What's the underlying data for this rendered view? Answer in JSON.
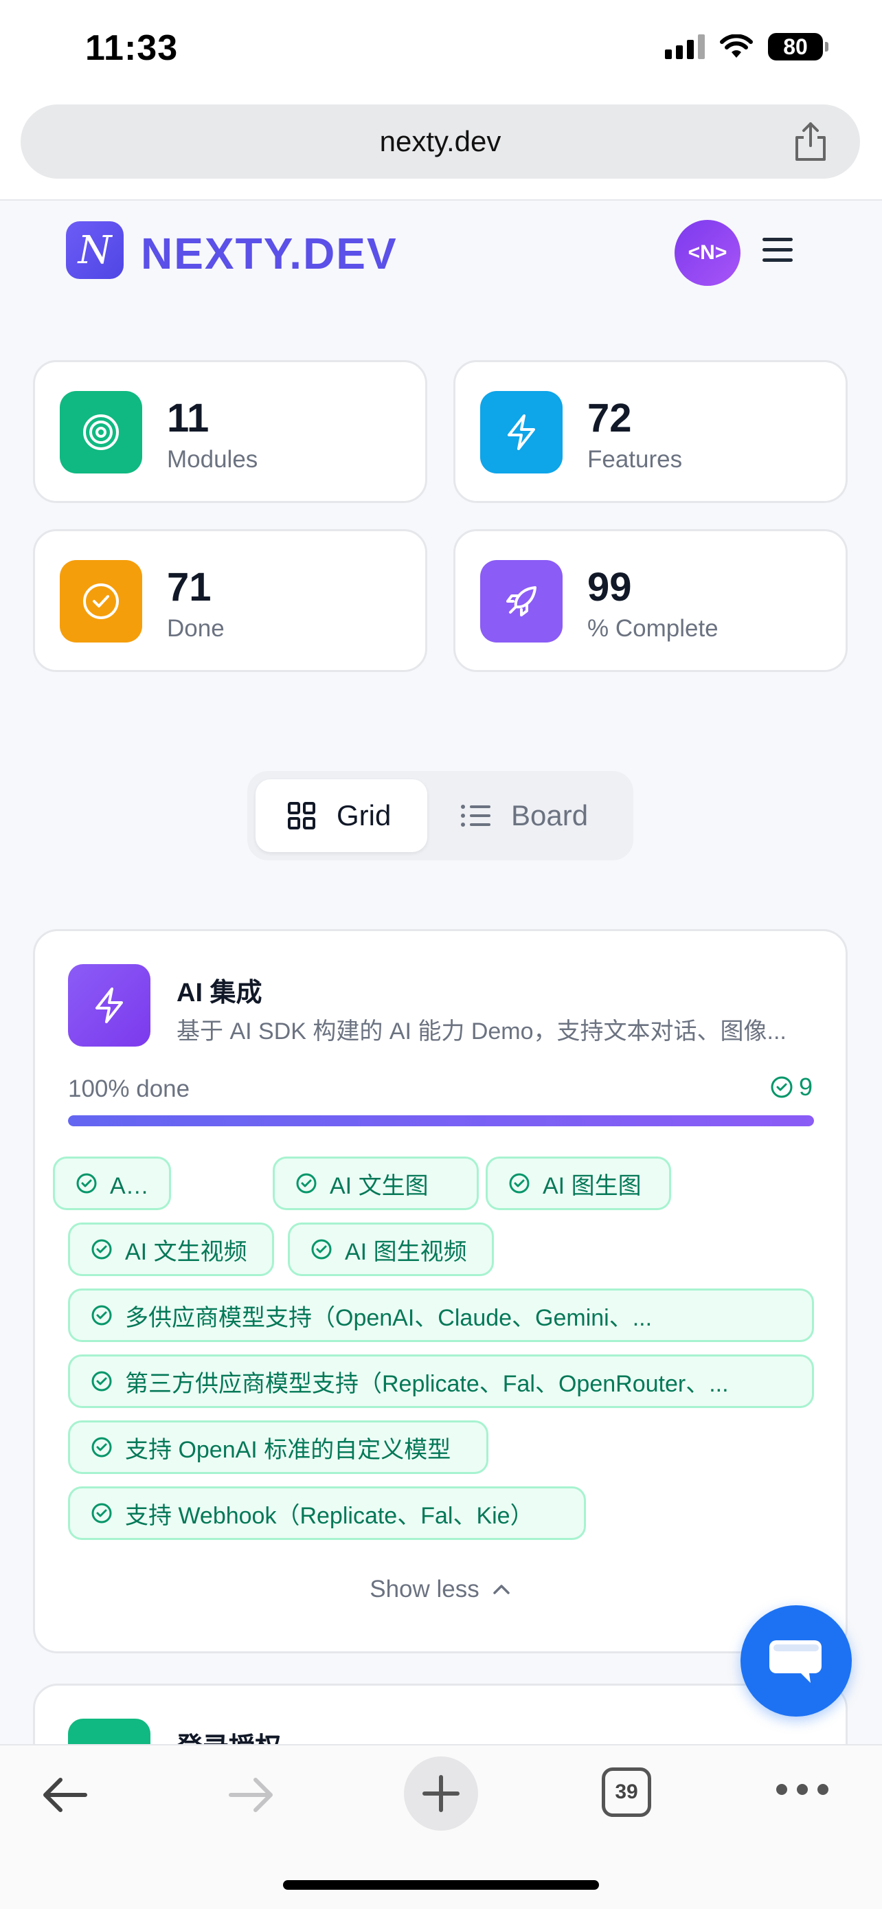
{
  "status_bar": {
    "time": "11:33",
    "battery": "80"
  },
  "browser": {
    "url": "nexty.dev",
    "open_tabs": "39"
  },
  "site": {
    "logo_text": "NEXTY.DEV",
    "logo_glyph": "N",
    "avatar_text": "<N>"
  },
  "stats": [
    {
      "value": "11",
      "label": "Modules",
      "color": "#10b981",
      "icon": "target-icon"
    },
    {
      "value": "72",
      "label": "Features",
      "color": "#0ea5e9",
      "icon": "lightning-icon"
    },
    {
      "value": "71",
      "label": "Done",
      "color": "#f59e0b",
      "icon": "check-circle-icon"
    },
    {
      "value": "99",
      "label": "% Complete",
      "color": "#8b5cf6",
      "icon": "rocket-icon"
    }
  ],
  "view_toggle": {
    "grid_label": "Grid",
    "board_label": "Board",
    "selected": "Grid"
  },
  "module": {
    "title": "AI 集成",
    "description": "基于 AI SDK 构建的 AI 能力 Demo，支持文本对话、图像...",
    "progress_label": "100% done",
    "progress": 1.0,
    "done_count": "9",
    "features": [
      "AI 文本对话",
      "AI 文生图",
      "AI 图生图",
      "AI 文生视频",
      "AI 图生视频",
      "多供应商模型支持（OpenAI、Claude、Gemini、...",
      "第三方供应商模型支持（Replicate、Fal、OpenRouter、...",
      "支持 OpenAI 标准的自定义模型",
      "支持 Webhook（Replicate、Fal、Kie）"
    ],
    "show_less_label": "Show less"
  },
  "next_module": {
    "title": "登录授权"
  }
}
